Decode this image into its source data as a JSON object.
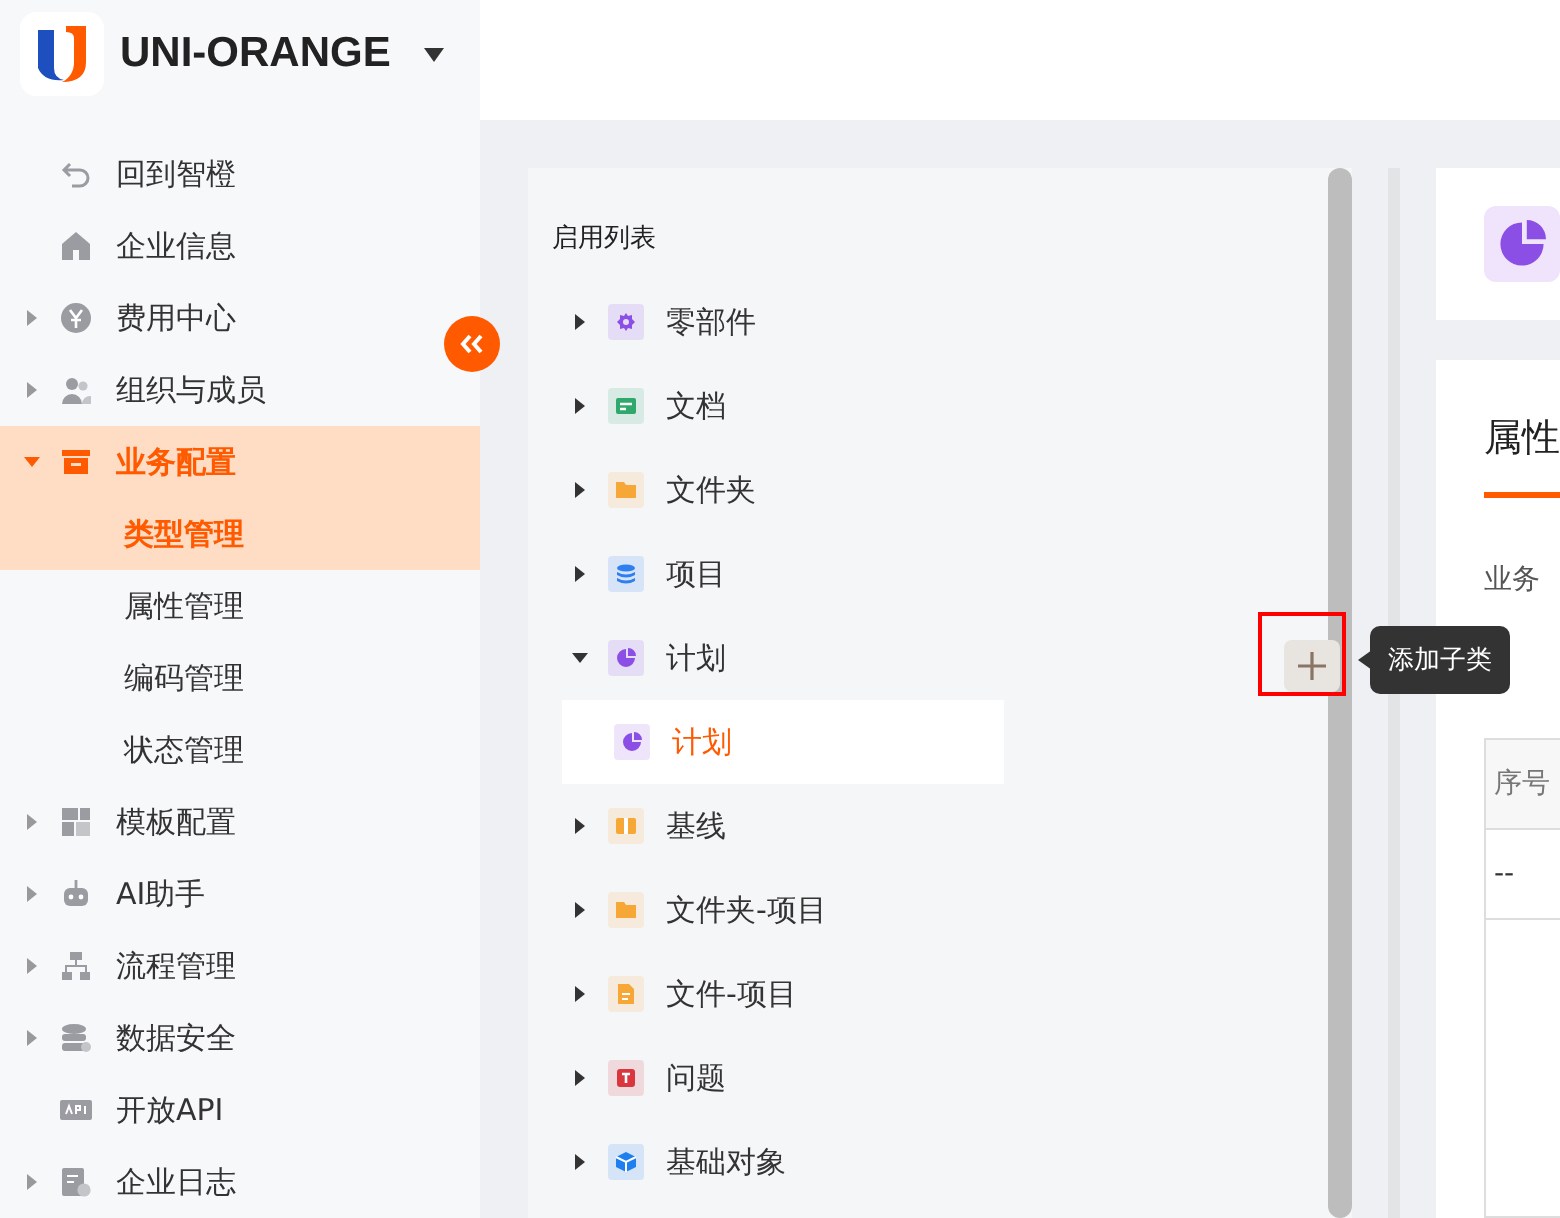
{
  "brand": {
    "name": "UNI-ORANGE"
  },
  "sidebar": {
    "items": [
      {
        "label": "回到智橙",
        "kind": "link"
      },
      {
        "label": "企业信息",
        "kind": "link"
      },
      {
        "label": "费用中心",
        "kind": "group",
        "expanded": false
      },
      {
        "label": "组织与成员",
        "kind": "group",
        "expanded": false
      },
      {
        "label": "业务配置",
        "kind": "group",
        "expanded": true,
        "children": [
          {
            "label": "类型管理",
            "selected": true
          },
          {
            "label": "属性管理",
            "selected": false
          },
          {
            "label": "编码管理",
            "selected": false
          },
          {
            "label": "状态管理",
            "selected": false
          }
        ]
      },
      {
        "label": "模板配置",
        "kind": "group",
        "expanded": false
      },
      {
        "label": "AI助手",
        "kind": "group",
        "expanded": false
      },
      {
        "label": "流程管理",
        "kind": "group",
        "expanded": false
      },
      {
        "label": "数据安全",
        "kind": "group",
        "expanded": false
      },
      {
        "label": "开放API",
        "kind": "link"
      },
      {
        "label": "企业日志",
        "kind": "group",
        "expanded": false
      }
    ]
  },
  "tree": {
    "title": "启用列表",
    "items": [
      {
        "label": "零部件",
        "color": "#8b4fe6",
        "expanded": false
      },
      {
        "label": "文档",
        "color": "#2fa86b",
        "expanded": false
      },
      {
        "label": "文件夹",
        "color": "#f7a736",
        "expanded": false
      },
      {
        "label": "项目",
        "color": "#2f7ff0",
        "expanded": false
      },
      {
        "label": "计划",
        "color": "#8b4fe6",
        "expanded": true,
        "children": [
          {
            "label": "计划",
            "color": "#8b4fe6",
            "selected": true
          }
        ]
      },
      {
        "label": "基线",
        "color": "#f7a736",
        "expanded": false
      },
      {
        "label": "文件夹-项目",
        "color": "#f7a736",
        "expanded": false
      },
      {
        "label": "文件-项目",
        "color": "#f7a736",
        "expanded": false
      },
      {
        "label": "问题",
        "color": "#d9363e",
        "expanded": false
      },
      {
        "label": "基础对象",
        "color": "#1f7ff0",
        "expanded": false
      }
    ],
    "tooltip": "添加子类"
  },
  "detail": {
    "tab": "属性",
    "field_label": "业务",
    "table": {
      "columns": [
        "序号"
      ],
      "rows": [
        [
          "--"
        ]
      ]
    }
  }
}
